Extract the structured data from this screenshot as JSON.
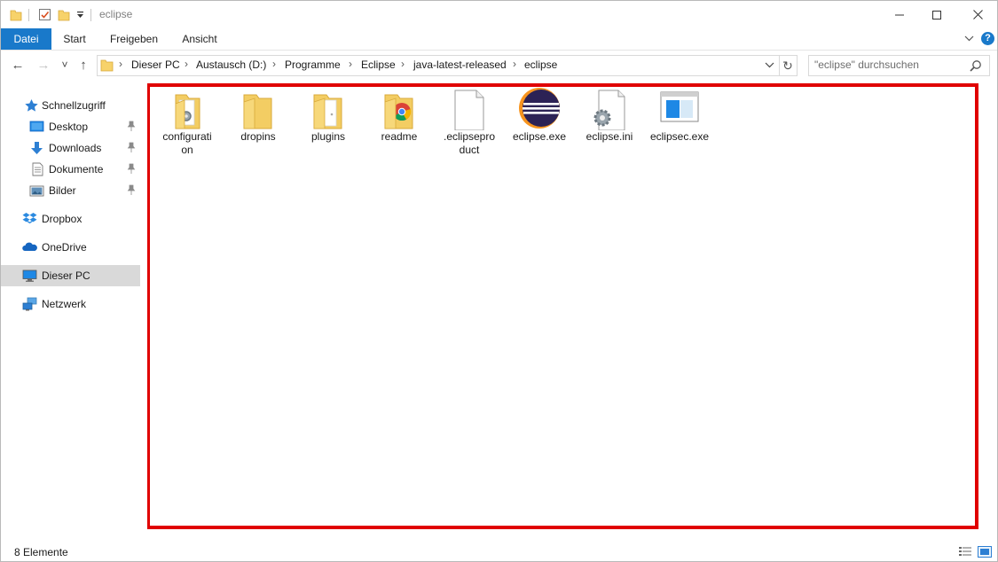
{
  "window": {
    "title": "eclipse",
    "minimize_glyph": "—",
    "maximize_glyph": "☐",
    "close_glyph": "✕"
  },
  "ribbon": {
    "tabs": [
      "Datei",
      "Start",
      "Freigeben",
      "Ansicht"
    ],
    "help_label": "?",
    "active_tab_color": "#1979ca"
  },
  "nav": {
    "back_glyph": "←",
    "forward_glyph": "→",
    "recent_glyph": "˅",
    "up_glyph": "↑",
    "breadcrumbs": [
      "Dieser PC",
      "Austausch (D:)",
      "Programme",
      "Eclipse",
      "java-latest-released",
      "eclipse"
    ],
    "crumb_separator": "›",
    "refresh_glyph": "↻",
    "search_placeholder": "\"eclipse\" durchsuchen"
  },
  "sidebar": {
    "items": [
      {
        "label": "Schnellzugriff",
        "icon": "star-icon"
      },
      {
        "label": "Desktop",
        "icon": "desktop-icon",
        "pinned": true
      },
      {
        "label": "Downloads",
        "icon": "download-arrow-icon",
        "pinned": true
      },
      {
        "label": "Dokumente",
        "icon": "document-icon",
        "pinned": true
      },
      {
        "label": "Bilder",
        "icon": "pictures-icon",
        "pinned": true
      },
      {
        "label": "Dropbox",
        "icon": "dropbox-icon"
      },
      {
        "label": "OneDrive",
        "icon": "onedrive-cloud-icon"
      },
      {
        "label": "Dieser PC",
        "icon": "computer-icon",
        "selected": true
      },
      {
        "label": "Netzwerk",
        "icon": "network-icon"
      }
    ]
  },
  "files": [
    {
      "name": "configurati\non",
      "icon": "folder-settings-icon"
    },
    {
      "name": "dropins",
      "icon": "folder-icon"
    },
    {
      "name": "plugins",
      "icon": "folder-icon"
    },
    {
      "name": "readme",
      "icon": "folder-chrome-icon"
    },
    {
      "name": ".eclipsepro\nduct",
      "icon": "blank-file-icon"
    },
    {
      "name": "eclipse.exe",
      "icon": "eclipse-icon"
    },
    {
      "name": "eclipse.ini",
      "icon": "ini-settings-file-icon"
    },
    {
      "name": "eclipsec.exe",
      "icon": "window-app-icon"
    }
  ],
  "highlight_color": "#e00000",
  "status": {
    "count_text": "8 Elemente"
  }
}
